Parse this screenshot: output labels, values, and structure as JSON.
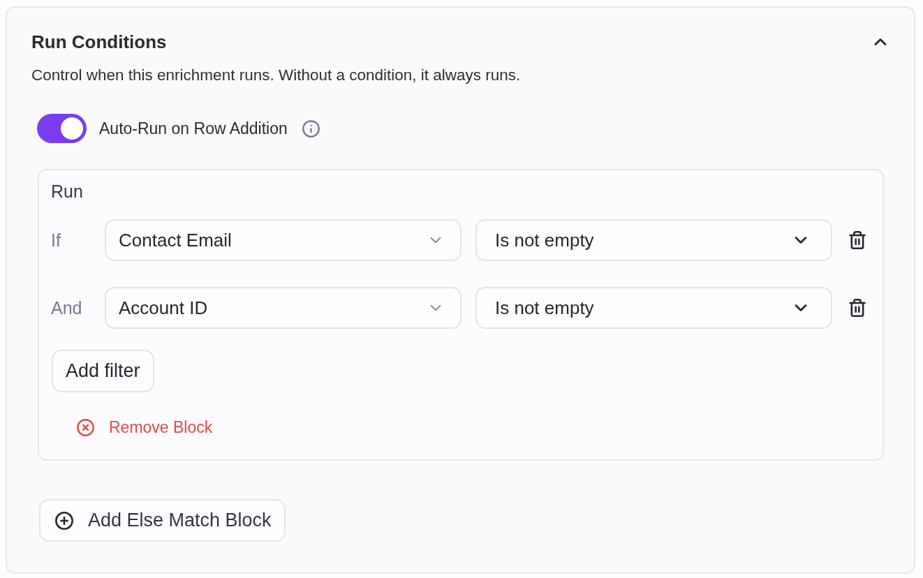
{
  "panel": {
    "title": "Run Conditions",
    "expanded": true,
    "description": "Control when this enrichment runs. Without a condition, it always runs."
  },
  "auto_run": {
    "label": "Auto-Run on Row Addition",
    "on": true
  },
  "block": {
    "heading": "Run",
    "filters": [
      {
        "connector": "If",
        "field": "Contact Email",
        "operator": "Is not empty"
      },
      {
        "connector": "And",
        "field": "Account ID",
        "operator": "Is not empty"
      }
    ],
    "add_filter": "Add filter",
    "remove": "Remove Block"
  },
  "add_else": "Add Else Match Block"
}
